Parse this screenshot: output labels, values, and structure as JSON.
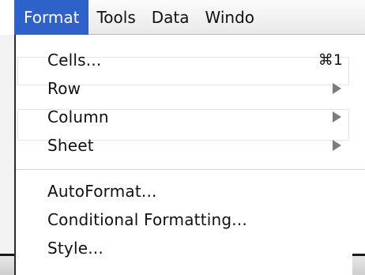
{
  "menubar": {
    "items": [
      "Format",
      "Tools",
      "Data",
      "Windo"
    ],
    "active_index": 0
  },
  "menu": {
    "items": [
      {
        "label": "Cells...",
        "shortcut": "⌘1",
        "submenu": false
      },
      {
        "label": "Row",
        "shortcut": "",
        "submenu": true
      },
      {
        "label": "Column",
        "shortcut": "",
        "submenu": true
      },
      {
        "label": "Sheet",
        "shortcut": "",
        "submenu": true
      },
      {
        "label": "AutoFormat...",
        "shortcut": "",
        "submenu": false
      },
      {
        "label": "Conditional Formatting...",
        "shortcut": "",
        "submenu": false
      },
      {
        "label": "Style...",
        "shortcut": "",
        "submenu": false
      }
    ]
  },
  "colors": {
    "highlight": "#2f62c9",
    "menu_text": "#111111",
    "arrow": "#7d7d7d"
  }
}
